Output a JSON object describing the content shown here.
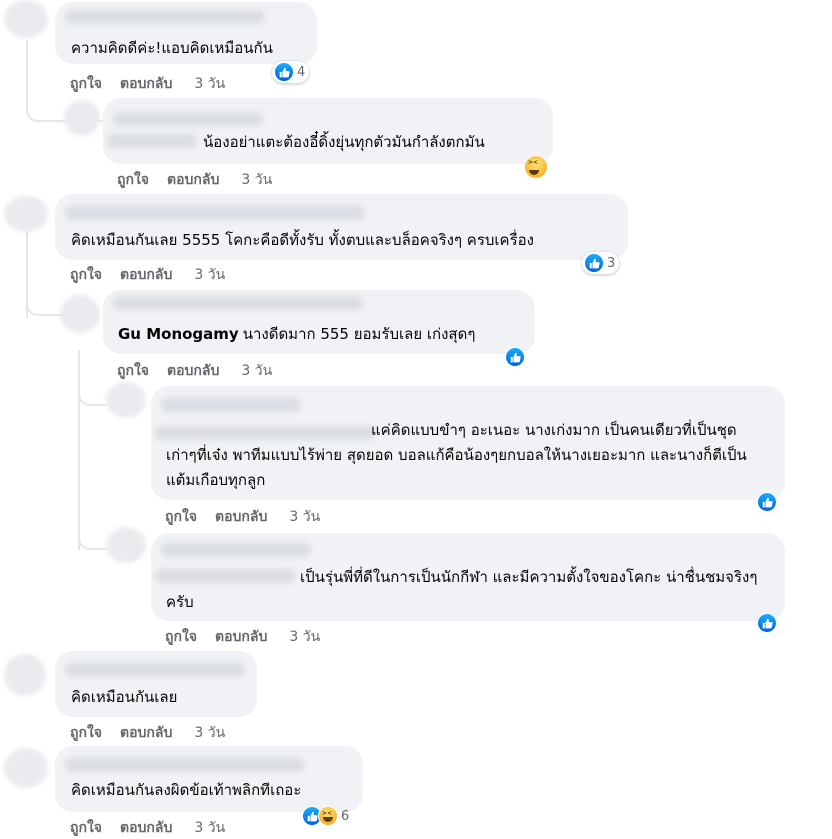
{
  "labels": {
    "like": "ถูกใจ",
    "reply": "ตอบกลับ",
    "time": "3 วัน"
  },
  "colors": {
    "like_blue": "#1877f2",
    "bubble_bg": "#f0f2f5",
    "meta_gray": "#65676b"
  },
  "comments": [
    {
      "author": "",
      "text": "ความคิดดีค่ะ!แอบคิดเหมือนกัน",
      "reactions": {
        "icons": [
          "like-icon"
        ],
        "count": "4"
      }
    },
    {
      "author": "",
      "text": "น้องอย่าแตะต้องอี๋ดิ้งยุ่นทุกตัวมันกำลังตกมัน",
      "reactions": {
        "icons": [
          "haha-icon"
        ],
        "count": ""
      }
    },
    {
      "author": "",
      "text": "คิดเหมือนกันเลย 5555 โคกะคือดีทั้งรับ ทั้งตบและบล็อคจริงๆ ครบเครื่อง",
      "reactions": {
        "icons": [
          "like-icon"
        ],
        "count": "3"
      }
    },
    {
      "author": "Gu Monogamy",
      "text": "นางดีดมาก 555 ยอมรับเลย เก่งสุดๆ",
      "reactions": {
        "icons": [
          "like-icon"
        ],
        "count": ""
      }
    },
    {
      "author": "",
      "text": "แค่คิดแบบขำๆ อะเนอะ นางเก่งมาก เป็นคนเดียวที่เป็นชุดเก่าๆที่เจ๋ง พาทีมแบบไร้พ่าย สุดยอด บอลแก้คือน้องๆยกบอลให้นางเยอะมาก และนางก็ตีเป็นแต้มเกือบทุกลูก",
      "reactions": {
        "icons": [
          "like-icon"
        ],
        "count": ""
      }
    },
    {
      "author": "",
      "text": "เป็นรุ่นพี่ที่ดีในการเป็นนักกีฬา และมีความตั้งใจของโคกะ น่าชื่นชมจริงๆ ครับ",
      "reactions": {
        "icons": [
          "like-icon"
        ],
        "count": ""
      }
    },
    {
      "author": "",
      "text": "คิดเหมือนกันเลย",
      "reactions": {
        "icons": [],
        "count": ""
      }
    },
    {
      "author": "",
      "text": "คิดเหมือนกันลงผิดข้อเท้าพลิกทีเถอะ",
      "reactions": {
        "icons": [
          "like-icon",
          "haha-icon"
        ],
        "count": "6"
      }
    }
  ]
}
